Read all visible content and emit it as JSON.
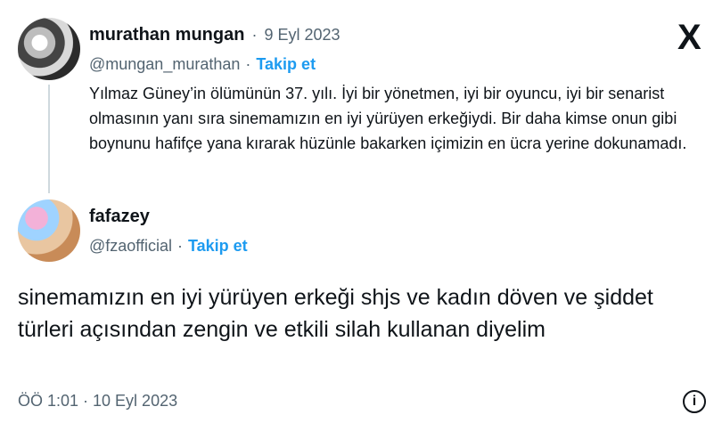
{
  "tweet": {
    "author_name": "murathan mungan",
    "separator": "·",
    "date": "9 Eyl 2023",
    "handle": "@mungan_murathan",
    "follow_label": "Takip et",
    "text": "Yılmaz Güney’in ölümünün 37.  yılı. İyi bir yönetmen, iyi bir oyuncu, iyi bir senarist olmasının yanı sıra sinemamızın en iyi yürüyen erkeğiydi. Bir daha kimse onun gibi boynunu hafifçe yana kırarak hüzünle bakarken içimizin en ücra yerine dokunamadı."
  },
  "reply": {
    "author_name": "fafazey",
    "handle": "@fzaofficial",
    "separator": "·",
    "follow_label": "Takip et",
    "text": "sinemamızın en iyi yürüyen erkeği shjs ve kadın döven ve şiddet türleri açısından zengin ve etkili silah kullanan diyelim",
    "timestamp": "ÖÖ 1:01 · 10 Eyl 2023"
  },
  "icons": {
    "brand": "x-logo-icon",
    "info": "info-icon"
  },
  "labels": {
    "x_logo": "X",
    "info_glyph": "i"
  },
  "colors": {
    "text": "#0f1419",
    "muted": "#536471",
    "link": "#1d9bf0",
    "thread_line": "#cfd9de"
  }
}
